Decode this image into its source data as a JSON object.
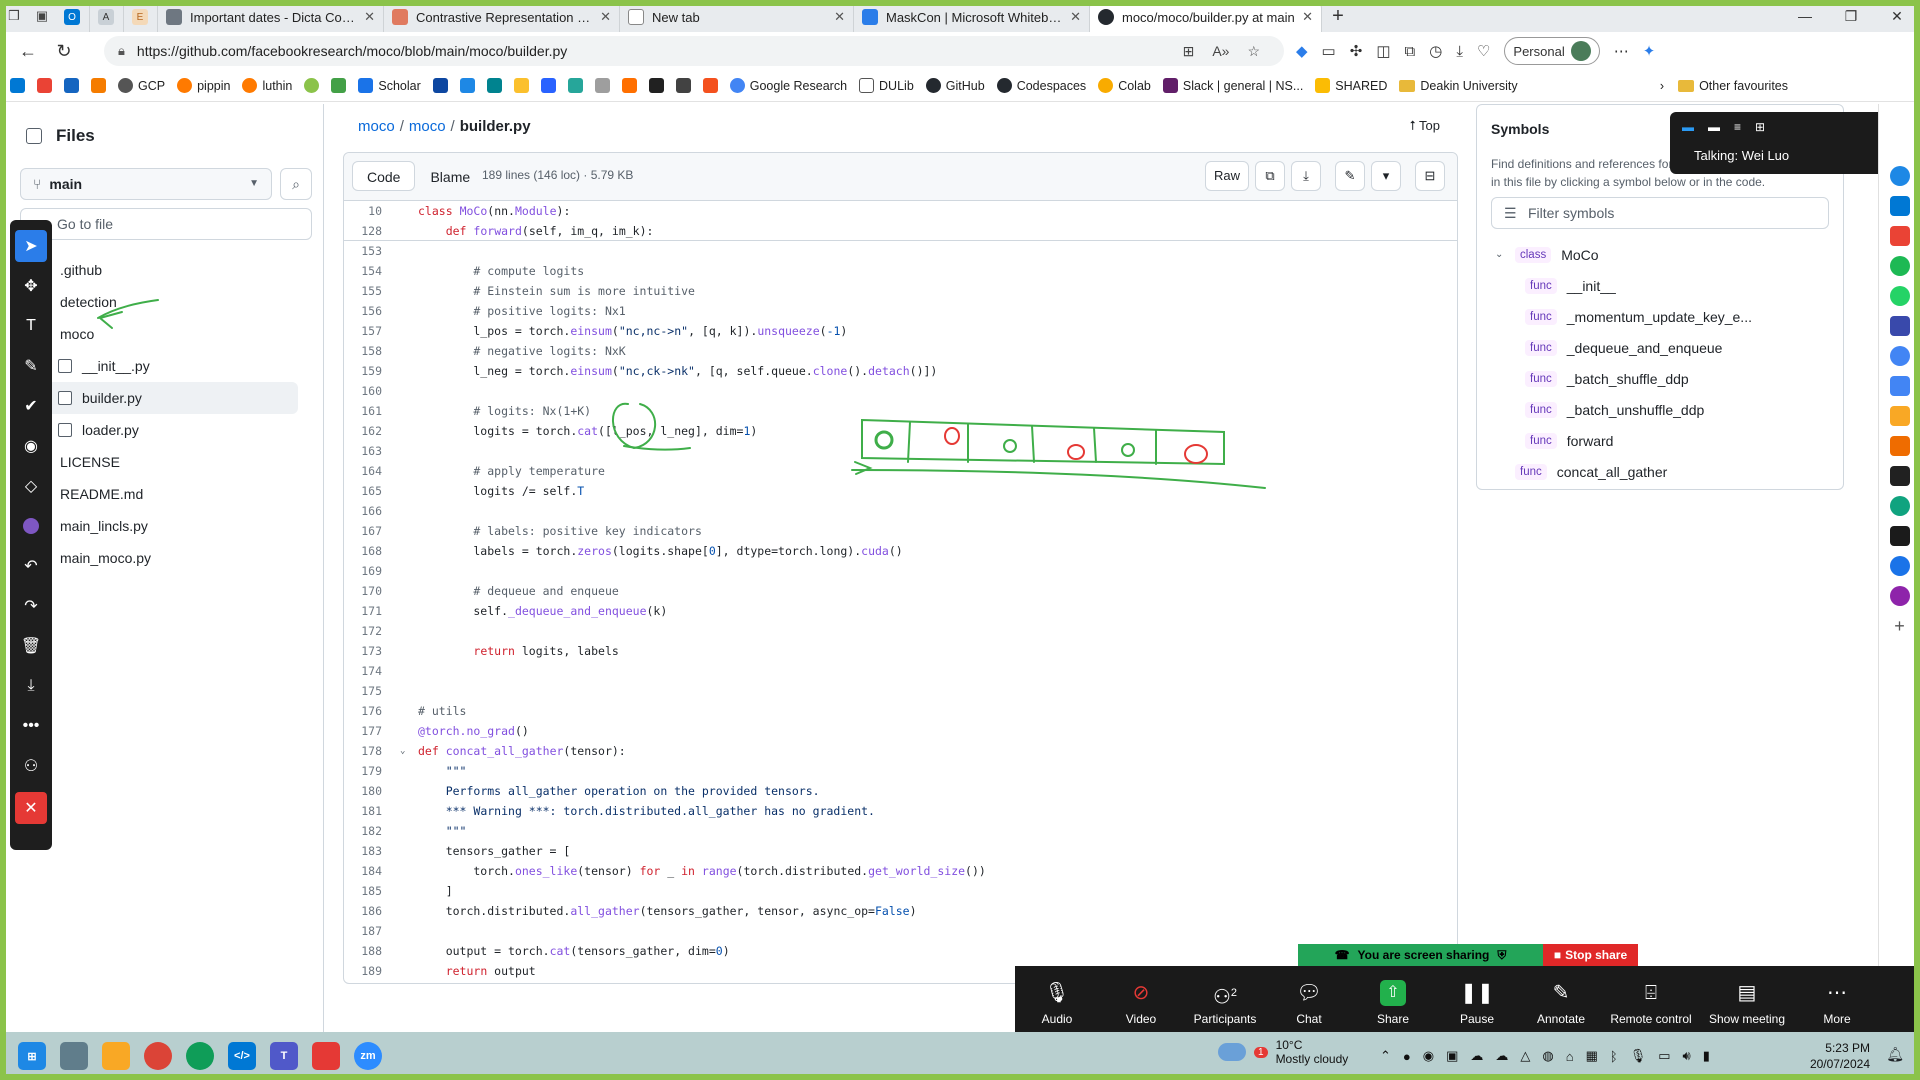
{
  "browser": {
    "tabs": [
      {
        "title": "Important dates - Dicta Conferen",
        "color": "#6e7781"
      },
      {
        "title": "Contrastive Representation Learn",
        "color": "#e07a5f"
      },
      {
        "title": "New tab",
        "color": "#6e7781"
      },
      {
        "title": "MaskCon | Microsoft Whiteboard",
        "color": "#2b7de9"
      },
      {
        "title": "moco/moco/builder.py at main",
        "color": "#24292f"
      }
    ],
    "url": "https://github.com/facebookresearch/moco/blob/main/moco/builder.py",
    "profile_label": "Personal",
    "bookmarks": [
      "GCP",
      "pippin",
      "luthin",
      "Scholar",
      "Google Research",
      "DULib",
      "GitHub",
      "Codespaces",
      "Colab",
      "Slack | general | NS...",
      "SHARED",
      "Deakin University"
    ],
    "other_favourites": "Other favourites"
  },
  "files": {
    "title": "Files",
    "branch": "main",
    "goto_placeholder": "Go to file",
    "tree": [
      {
        "name": ".github",
        "type": "folder",
        "level": 0
      },
      {
        "name": "detection",
        "type": "folder",
        "level": 0
      },
      {
        "name": "moco",
        "type": "folder",
        "level": 0
      },
      {
        "name": "__init__.py",
        "type": "file",
        "level": 1
      },
      {
        "name": "builder.py",
        "type": "file",
        "level": 1,
        "selected": true
      },
      {
        "name": "loader.py",
        "type": "file",
        "level": 1
      },
      {
        "name": "LICENSE",
        "type": "file",
        "level": 0
      },
      {
        "name": "README.md",
        "type": "file",
        "level": 0
      },
      {
        "name": "main_lincls.py",
        "type": "file",
        "level": 0
      },
      {
        "name": "main_moco.py",
        "type": "file",
        "level": 0
      }
    ]
  },
  "breadcrumb": {
    "repo": "moco",
    "dir": "moco",
    "file": "builder.py",
    "top_label": "Top"
  },
  "code_header": {
    "code_tab": "Code",
    "blame_tab": "Blame",
    "file_info": "189 lines (146 loc) · 5.79 KB",
    "raw_label": "Raw"
  },
  "sticky_lines": [
    {
      "num": "10",
      "html": "<span class=\"kw\">class</span> <span class=\"fn\">MoCo</span>(nn.<span class=\"fn\">Module</span>):"
    },
    {
      "num": "128",
      "html": "    <span class=\"kw\">def</span> <span class=\"fn\">forward</span>(self, im_q, im_k):"
    }
  ],
  "code_lines": [
    {
      "num": "153",
      "html": ""
    },
    {
      "num": "154",
      "html": "        <span class=\"cm\"># compute logits</span>"
    },
    {
      "num": "155",
      "html": "        <span class=\"cm\"># Einstein sum is more intuitive</span>"
    },
    {
      "num": "156",
      "html": "        <span class=\"cm\"># positive logits: Nx1</span>"
    },
    {
      "num": "157",
      "html": "        l_pos = torch.<span class=\"fn\">einsum</span>(<span class=\"st\">\"nc,nc->n\"</span>, [q, k]).<span class=\"fn\">unsqueeze</span>(<span class=\"cn\">-1</span>)"
    },
    {
      "num": "158",
      "html": "        <span class=\"cm\"># negative logits: NxK</span>"
    },
    {
      "num": "159",
      "html": "        l_neg = torch.<span class=\"fn\">einsum</span>(<span class=\"st\">\"nc,ck->nk\"</span>, [q, self.queue.<span class=\"fn\">clone</span>().<span class=\"fn\">detach</span>()])"
    },
    {
      "num": "160",
      "html": ""
    },
    {
      "num": "161",
      "html": "        <span class=\"cm\"># logits: Nx(1+K)</span>"
    },
    {
      "num": "162",
      "html": "        logits = torch.<span class=\"fn\">cat</span>([l_pos, l_neg], dim=<span class=\"cn\">1</span>)"
    },
    {
      "num": "163",
      "html": ""
    },
    {
      "num": "164",
      "html": "        <span class=\"cm\"># apply temperature</span>"
    },
    {
      "num": "165",
      "html": "        logits /= self.<span class=\"cn\">T</span>"
    },
    {
      "num": "166",
      "html": ""
    },
    {
      "num": "167",
      "html": "        <span class=\"cm\"># labels: positive key indicators</span>"
    },
    {
      "num": "168",
      "html": "        labels = torch.<span class=\"fn\">zeros</span>(logits.shape[<span class=\"cn\">0</span>], dtype=torch.long).<span class=\"fn\">cuda</span>()"
    },
    {
      "num": "169",
      "html": ""
    },
    {
      "num": "170",
      "html": "        <span class=\"cm\"># dequeue and enqueue</span>"
    },
    {
      "num": "171",
      "html": "        self.<span class=\"fn\">_dequeue_and_enqueue</span>(k)"
    },
    {
      "num": "172",
      "html": ""
    },
    {
      "num": "173",
      "html": "        <span class=\"kw\">return</span> logits, labels"
    },
    {
      "num": "174",
      "html": ""
    },
    {
      "num": "175",
      "html": ""
    },
    {
      "num": "176",
      "html": "<span class=\"cm\"># utils</span>"
    },
    {
      "num": "177",
      "html": "<span class=\"fn\">@torch.no_grad</span>()"
    },
    {
      "num": "178",
      "html": "<span class=\"kw\">def</span> <span class=\"fn\">concat_all_gather</span>(tensor):",
      "fold": true
    },
    {
      "num": "179",
      "html": "    <span class=\"st\">\"\"\"</span>"
    },
    {
      "num": "180",
      "html": "    <span class=\"st\">Performs all_gather operation on the provided tensors.</span>"
    },
    {
      "num": "181",
      "html": "    <span class=\"st\">*** Warning ***: torch.distributed.all_gather has no gradient.</span>"
    },
    {
      "num": "182",
      "html": "    <span class=\"st\">\"\"\"</span>"
    },
    {
      "num": "183",
      "html": "    tensors_gather = ["
    },
    {
      "num": "184",
      "html": "        torch.<span class=\"fn\">ones_like</span>(tensor) <span class=\"kw\">for</span> _ <span class=\"kw\">in</span> <span class=\"fn\">range</span>(torch.distributed.<span class=\"fn\">get_world_size</span>())"
    },
    {
      "num": "185",
      "html": "    ]"
    },
    {
      "num": "186",
      "html": "    torch.distributed.<span class=\"fn\">all_gather</span>(tensors_gather, tensor, async_op=<span class=\"cn\">False</span>)"
    },
    {
      "num": "187",
      "html": ""
    },
    {
      "num": "188",
      "html": "    output = torch.<span class=\"fn\">cat</span>(tensors_gather, dim=<span class=\"cn\">0</span>)"
    },
    {
      "num": "189",
      "html": "    <span class=\"kw\">return</span> output"
    }
  ],
  "symbols": {
    "title": "Symbols",
    "description": "Find definitions and references for functions and other symbols in this file by clicking a symbol below or in the code.",
    "filter_placeholder": "Filter symbols",
    "items": [
      {
        "kind": "class",
        "name": "MoCo",
        "level": "top"
      },
      {
        "kind": "func",
        "name": "__init__",
        "level": "nest"
      },
      {
        "kind": "func",
        "name": "_momentum_update_key_e...",
        "level": "nest"
      },
      {
        "kind": "func",
        "name": "_dequeue_and_enqueue",
        "level": "nest"
      },
      {
        "kind": "func",
        "name": "_batch_shuffle_ddp",
        "level": "nest"
      },
      {
        "kind": "func",
        "name": "_batch_unshuffle_ddp",
        "level": "nest"
      },
      {
        "kind": "func",
        "name": "forward",
        "level": "nest"
      },
      {
        "kind": "func",
        "name": "concat_all_gather",
        "level": "top2"
      }
    ]
  },
  "zoom": {
    "talking": "Talking: Wei Luo",
    "sharing_text": "You are screen sharing",
    "stop_share": "Stop share",
    "participants_count": "2",
    "buttons": [
      "Audio",
      "Video",
      "Participants",
      "Chat",
      "Share",
      "Pause",
      "Annotate",
      "Remote control",
      "Show meeting",
      "More"
    ]
  },
  "taskbar": {
    "weather_temp": "10°C",
    "weather_desc": "Mostly cloudy",
    "weather_badge": "1",
    "time": "5:23 PM",
    "date": "20/07/2024"
  },
  "colors": {
    "ink_green": "#3fae49",
    "ink_red": "#e53935",
    "frame_green": "#8bc34a",
    "link_blue": "#0969da"
  }
}
